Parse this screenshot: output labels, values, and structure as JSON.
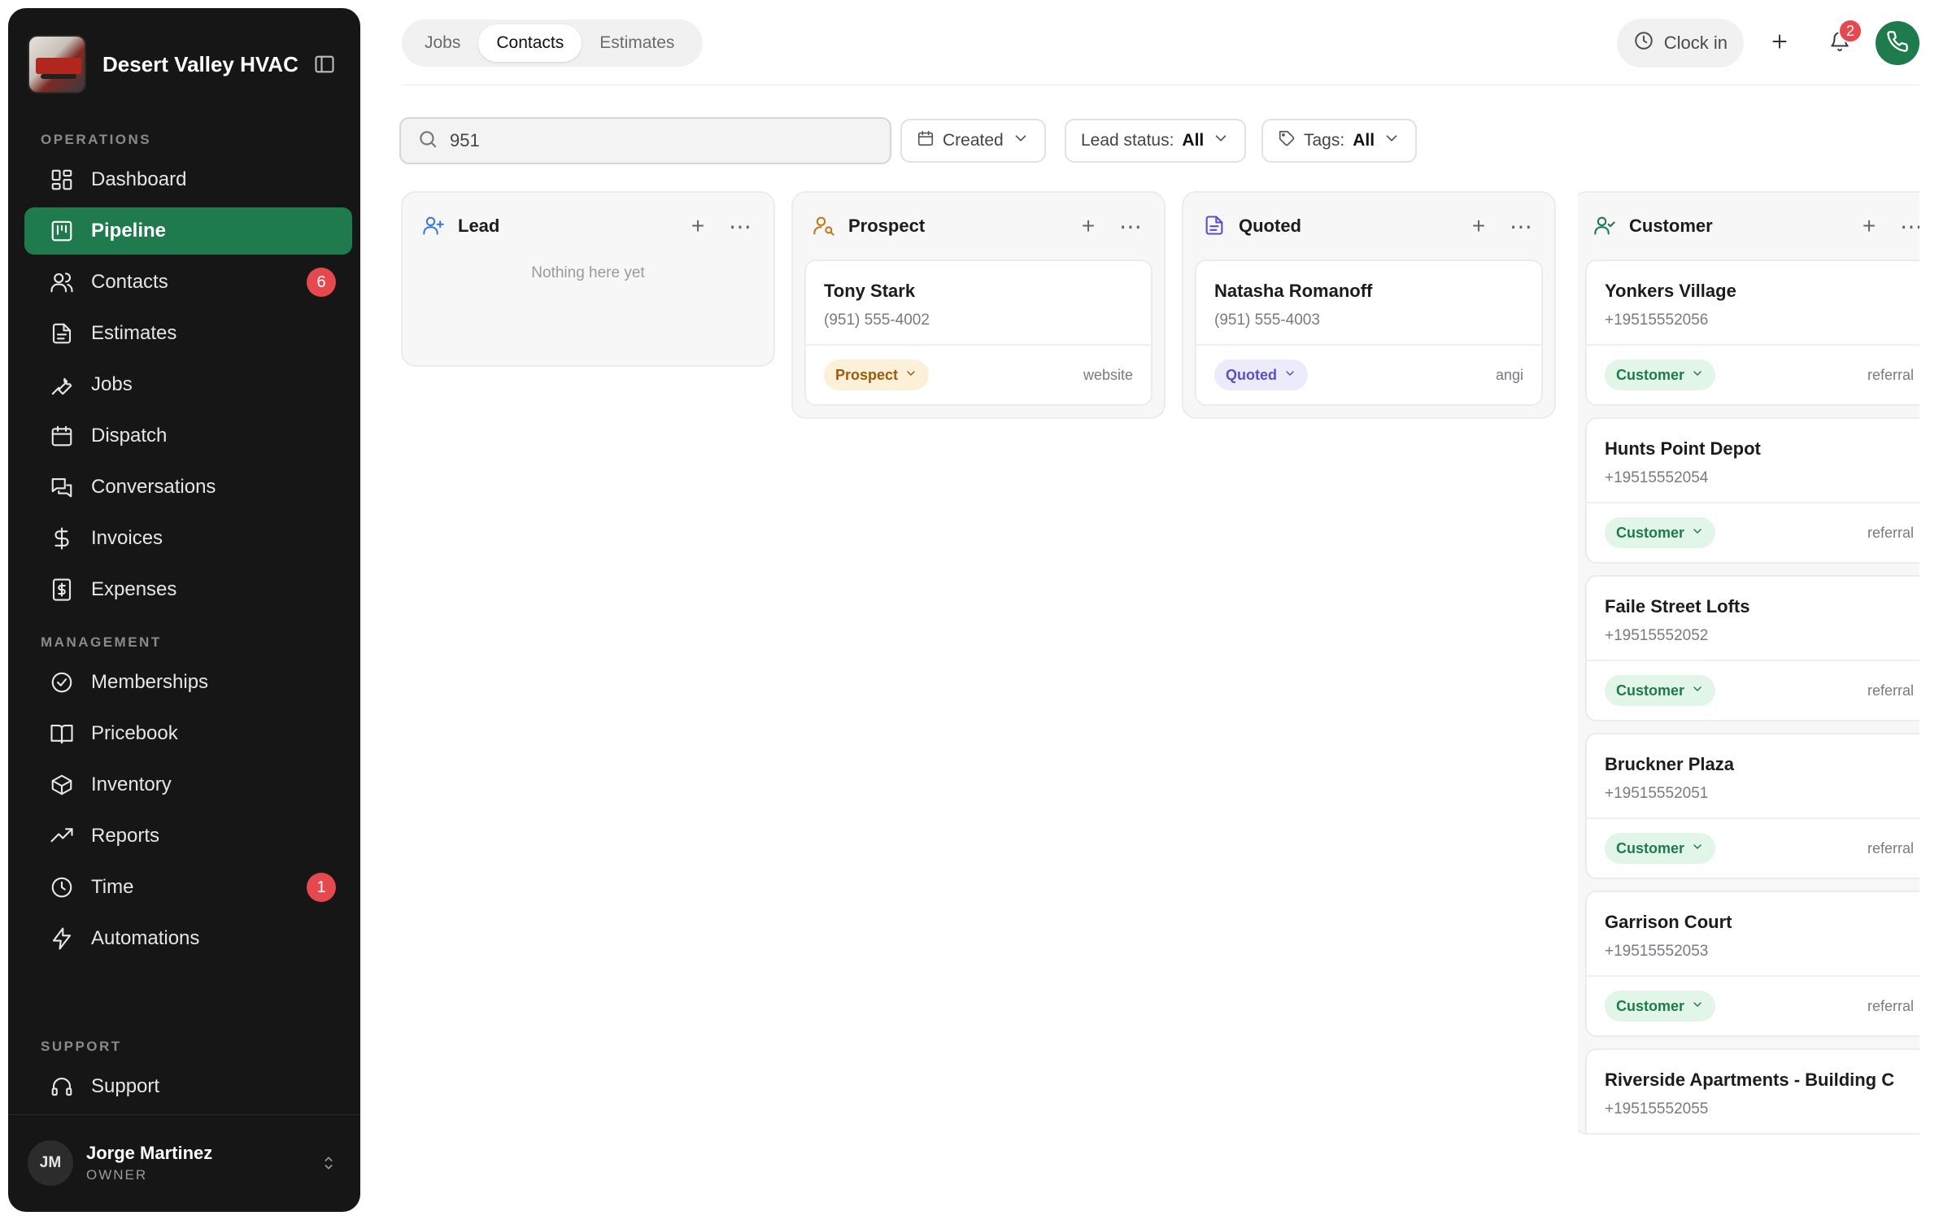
{
  "company": {
    "name": "Desert Valley HVAC"
  },
  "sidebar": {
    "sections": {
      "operations": "OPERATIONS",
      "management": "MANAGEMENT",
      "support": "SUPPORT"
    },
    "items": [
      {
        "label": "Dashboard",
        "icon": "dashboard-icon"
      },
      {
        "label": "Pipeline",
        "icon": "pipeline-icon",
        "active": true
      },
      {
        "label": "Contacts",
        "icon": "contacts-icon",
        "badge": "6"
      },
      {
        "label": "Estimates",
        "icon": "estimates-icon"
      },
      {
        "label": "Jobs",
        "icon": "wrench-icon"
      },
      {
        "label": "Dispatch",
        "icon": "calendar-icon"
      },
      {
        "label": "Conversations",
        "icon": "chat-icon"
      },
      {
        "label": "Invoices",
        "icon": "dollar-icon"
      },
      {
        "label": "Expenses",
        "icon": "receipt-icon"
      },
      {
        "label": "Memberships",
        "icon": "badge-check-icon"
      },
      {
        "label": "Pricebook",
        "icon": "book-icon"
      },
      {
        "label": "Inventory",
        "icon": "box-icon"
      },
      {
        "label": "Reports",
        "icon": "trend-icon"
      },
      {
        "label": "Time",
        "icon": "clock-icon",
        "badge": "1"
      },
      {
        "label": "Automations",
        "icon": "bolt-icon"
      },
      {
        "label": "Support",
        "icon": "headset-icon"
      }
    ],
    "user": {
      "initials": "JM",
      "name": "Jorge Martinez",
      "role": "OWNER"
    }
  },
  "topbar": {
    "tabs": [
      "Jobs",
      "Contacts",
      "Estimates"
    ],
    "active_tab": "Contacts",
    "clock_label": "Clock in",
    "notification_count": "2"
  },
  "filters": {
    "search_value": "951",
    "created_label": "Created",
    "lead_status_label": "Lead status:",
    "lead_status_value": "All",
    "tags_label": "Tags:",
    "tags_value": "All"
  },
  "colors": {
    "accent": "#1f7a4e",
    "badge": "#e5484d",
    "sidebar_bg": "#161616"
  },
  "board": {
    "columns": [
      {
        "title": "Lead",
        "icon": "user-plus-icon",
        "empty_text": "Nothing here yet",
        "cards": []
      },
      {
        "title": "Prospect",
        "icon": "user-search-icon",
        "cards": [
          {
            "name": "Tony Stark",
            "phone": "(951) 555-4002",
            "status": "Prospect",
            "source": "website"
          }
        ]
      },
      {
        "title": "Quoted",
        "icon": "document-icon",
        "cards": [
          {
            "name": "Natasha Romanoff",
            "phone": "(951) 555-4003",
            "status": "Quoted",
            "source": "angi"
          }
        ]
      },
      {
        "title": "Customer",
        "icon": "user-check-icon",
        "cards": [
          {
            "name": "Yonkers Village",
            "phone": "+19515552056",
            "status": "Customer",
            "source": "referral"
          },
          {
            "name": "Hunts Point Depot",
            "phone": "+19515552054",
            "status": "Customer",
            "source": "referral"
          },
          {
            "name": "Faile Street Lofts",
            "phone": "+19515552052",
            "status": "Customer",
            "source": "referral"
          },
          {
            "name": "Bruckner Plaza",
            "phone": "+19515552051",
            "status": "Customer",
            "source": "referral"
          },
          {
            "name": "Garrison Court",
            "phone": "+19515552053",
            "status": "Customer",
            "source": "referral"
          },
          {
            "name": "Riverside Apartments - Building C",
            "phone": "+19515552055"
          }
        ]
      }
    ]
  }
}
